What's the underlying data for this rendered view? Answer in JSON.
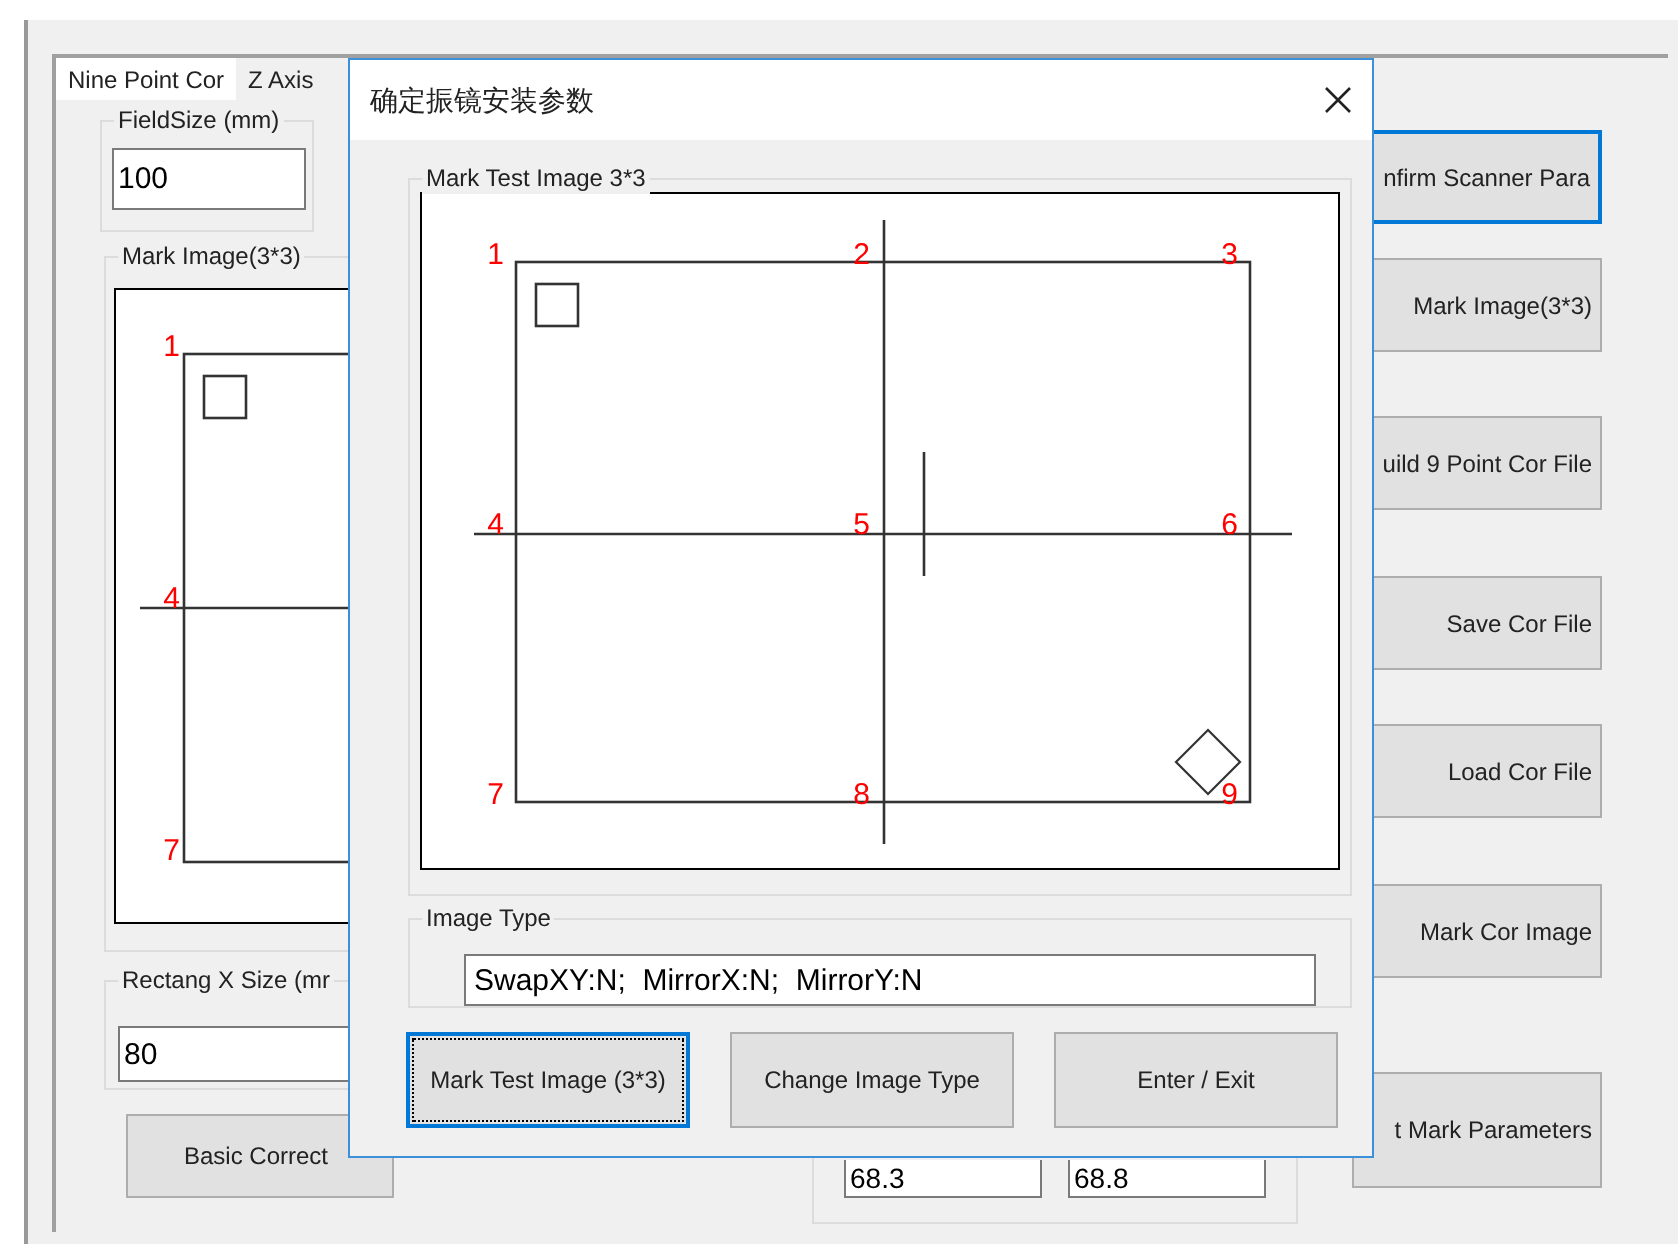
{
  "tabs": [
    {
      "label": "Nine Point Cor",
      "selected": true
    },
    {
      "label": "Z Axis",
      "selected": false
    }
  ],
  "field_size": {
    "label": "FieldSize (mm)",
    "value": "100"
  },
  "mark_image": {
    "label": "Mark Image(3*3)",
    "points": [
      "1",
      "4",
      "7"
    ]
  },
  "rectang_x_size": {
    "label": "Rectang X Size (mr",
    "value": "80"
  },
  "basic_correct_button": "Basic Correct",
  "coordinate_fields": [
    "68.3",
    "68.8"
  ],
  "side_buttons": [
    {
      "label": "nfirm Scanner Para",
      "focused": true
    },
    {
      "label": "Mark Image(3*3)",
      "focused": false
    },
    {
      "label": "uild 9 Point Cor File",
      "focused": false
    },
    {
      "label": "Save Cor File",
      "focused": false
    },
    {
      "label": "Load Cor File",
      "focused": false
    },
    {
      "label": "Mark Cor Image",
      "focused": false
    },
    {
      "label": "t Mark Parameters",
      "focused": false
    }
  ],
  "dialog": {
    "title": "确定振镜安装参数",
    "test_image": {
      "label": "Mark Test Image 3*3",
      "points": [
        "1",
        "2",
        "3",
        "4",
        "5",
        "6",
        "7",
        "8",
        "9"
      ]
    },
    "image_type": {
      "label": "Image Type",
      "value": "SwapXY:N;  MirrorX:N;  MirrorY:N"
    },
    "buttons": [
      {
        "label": "Mark Test Image (3*3)",
        "focused": true
      },
      {
        "label": "Change Image Type",
        "focused": false
      },
      {
        "label": "Enter / Exit",
        "focused": false
      }
    ]
  }
}
